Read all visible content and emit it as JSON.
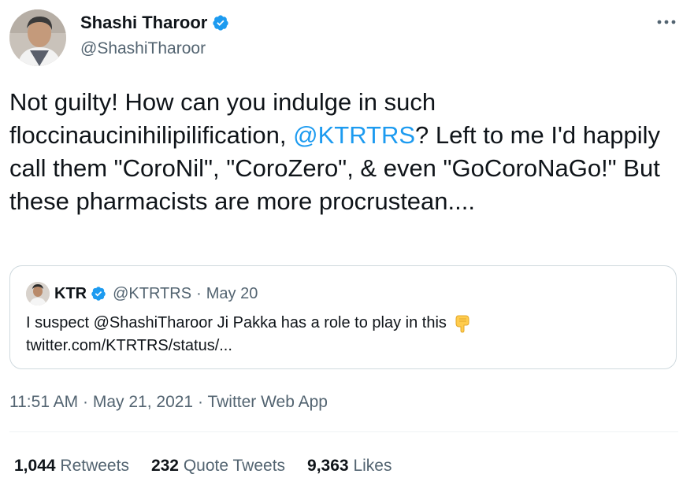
{
  "author": {
    "name": "Shashi Tharoor",
    "handle": "@ShashiTharoor"
  },
  "tweet": {
    "text_before": "Not guilty! How can you indulge in such floccinaucinihilipilification, ",
    "mention": "@KTRTRS",
    "text_after": "? Left to me I'd happily call them \"CoroNil\", \"CoroZero\", & even \"GoCoroNaGo!\" But these pharmacists are more procrustean...."
  },
  "quote": {
    "name": "KTR",
    "handle": "@KTRTRS",
    "separator": "·",
    "date": "May 20",
    "text": "I suspect @ShashiTharoor Ji Pakka has a role to play in this",
    "link": "twitter.com/KTRTRS/status/..."
  },
  "meta": {
    "time": "11:51 AM",
    "sep1": "·",
    "date": "May 21, 2021",
    "sep2": "·",
    "app": "Twitter Web App"
  },
  "stats": {
    "retweets_count": "1,044",
    "retweets_label": "Retweets",
    "quotes_count": "232",
    "quotes_label": "Quote Tweets",
    "likes_count": "9,363",
    "likes_label": "Likes"
  },
  "icons": {
    "verified": "verified-badge-icon",
    "more": "more-horizontal-icon",
    "emoji": "backhand-index-pointing-down-emoji"
  },
  "colors": {
    "link": "#1d9bf0",
    "secondary_text": "#536471",
    "border": "#cfd9de"
  }
}
